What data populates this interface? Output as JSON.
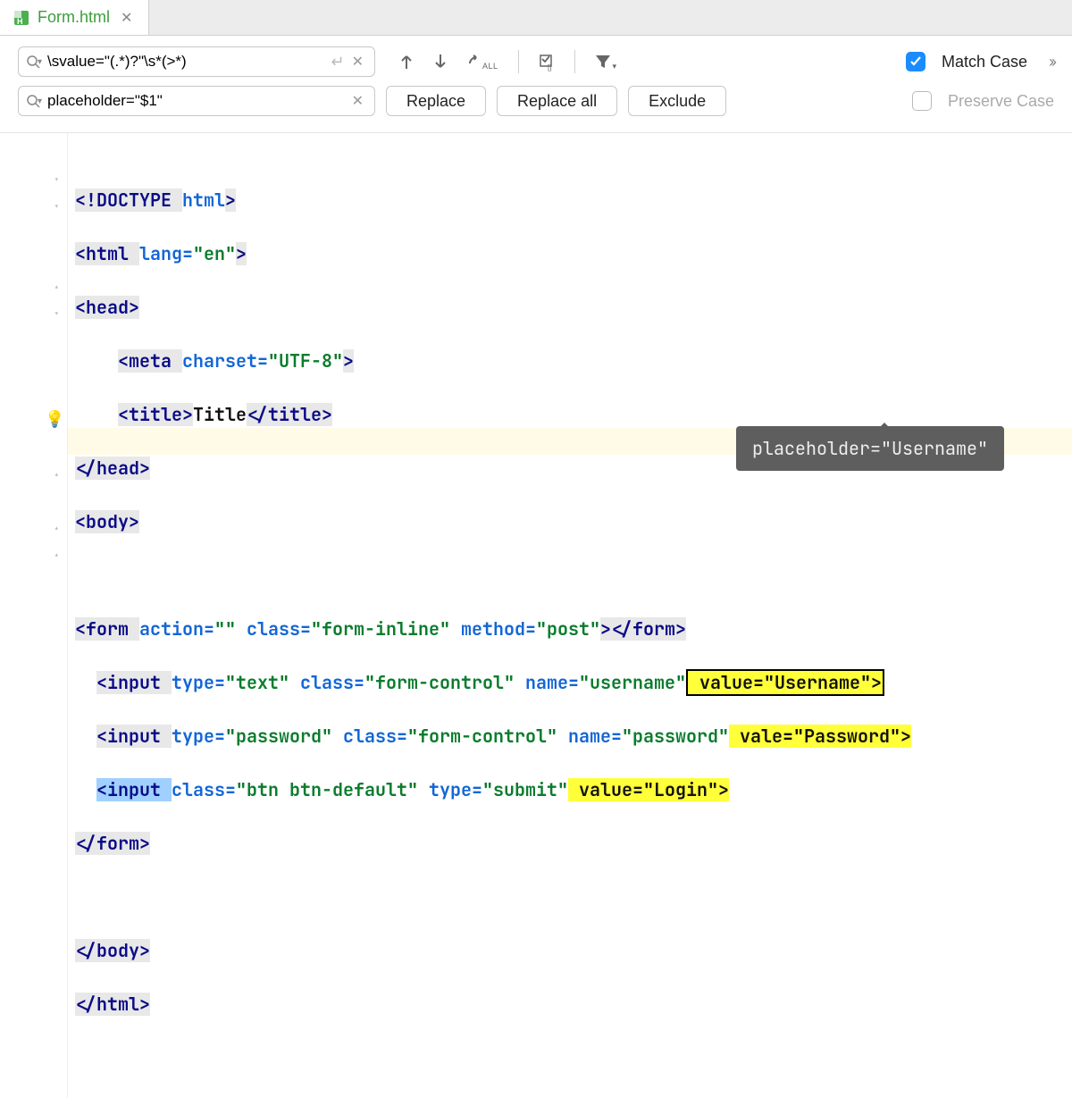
{
  "tab": {
    "filename": "Form.html"
  },
  "search": {
    "find_value": "\\svalue=\"(.*)?\"\\s*(>*)",
    "replace_value": "placeholder=\"$1\""
  },
  "buttons": {
    "replace": "Replace",
    "replace_all": "Replace all",
    "exclude": "Exclude"
  },
  "options": {
    "match_case": "Match Case",
    "preserve_case": "Preserve Case",
    "match_case_checked": true,
    "preserve_case_checked": false
  },
  "tooltip": "placeholder=\"Username\"",
  "code": {
    "l1_doctype": "<!DOCTYPE ",
    "l1_html": "html",
    "l1_end": ">",
    "l2_open": "<html ",
    "l2_attr": "lang=",
    "l2_val": "\"en\"",
    "l2_close": ">",
    "l3": "<head>",
    "l4_pre": "    ",
    "l4_open": "<meta ",
    "l4_attr": "charset=",
    "l4_val": "\"UTF-8\"",
    "l4_close": ">",
    "l5_pre": "    ",
    "l5_open": "<title>",
    "l5_txt": "Title",
    "l5_close": "</title>",
    "l6": "</head>",
    "l7": "<body>",
    "l9_open": "<form ",
    "l9_a1": "action=",
    "l9_v1": "\"\"",
    "l9_sp1": " ",
    "l9_a2": "class=",
    "l9_v2": "\"form-inline\"",
    "l9_sp2": " ",
    "l9_a3": "method=",
    "l9_v3": "\"post\"",
    "l9_close": "></form>",
    "l10_pre": "  ",
    "l10_open": "<input ",
    "l10_a1": "type=",
    "l10_v1": "\"text\"",
    "l10_a2": "class=",
    "l10_v2": "\"form-control\"",
    "l10_a3": "name=",
    "l10_v3": "\"username\"",
    "l10_hl": " value=\"Username\">",
    "l11_pre": "  ",
    "l11_open": "<input ",
    "l11_a1": "type=",
    "l11_v1": "\"password\"",
    "l11_a2": "class=",
    "l11_v2": "\"form-control\"",
    "l11_a3": "name=",
    "l11_v3": "\"password\"",
    "l11_hla": " val",
    "l11_hlb": "e=\"Password\">",
    "l12_pre": "  ",
    "l12_open": "<input ",
    "l12_a1": "class=",
    "l12_v1": "\"btn btn-default\"",
    "l12_a2": "type=",
    "l12_v2": "\"submit\"",
    "l12_hl": " value=\"Login\">",
    "l13": "</form>",
    "l15": "</body>",
    "l16": "</html>"
  }
}
